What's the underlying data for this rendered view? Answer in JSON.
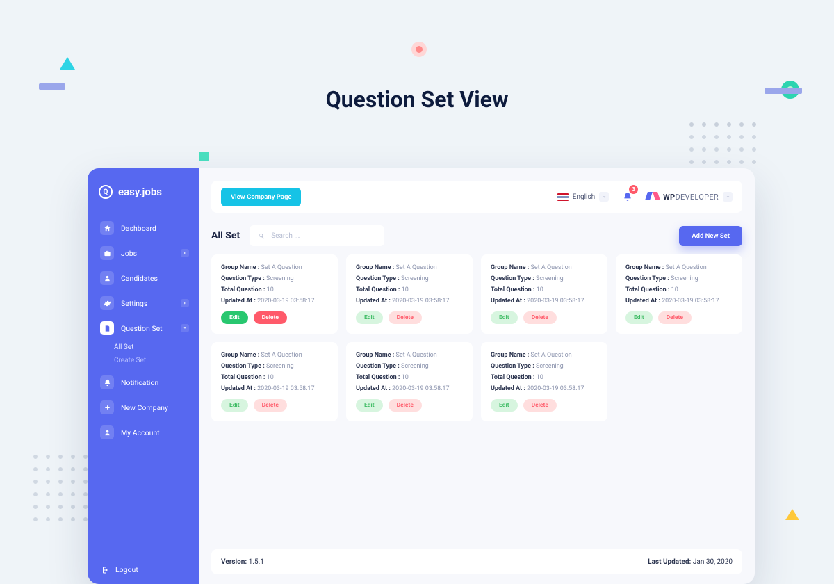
{
  "page_heading": "Question Set View",
  "logo_text": "easy.jobs",
  "sidebar": {
    "dashboard": "Dashboard",
    "jobs": "Jobs",
    "candidates": "Candidates",
    "settings": "Settings",
    "question_set": "Question Set",
    "qs_all": "All Set",
    "qs_create": "Create Set",
    "notification": "Notification",
    "new_company": "New Company",
    "my_account": "My Account",
    "logout": "Logout"
  },
  "topbar": {
    "view_company": "View Company Page",
    "language": "English",
    "notif_count": "3",
    "brand_main": "WP",
    "brand_sub": "DEVELOPER"
  },
  "section": {
    "title": "All Set",
    "search_placeholder": "Search ...",
    "add_btn": "Add New Set"
  },
  "labels": {
    "group": "Group Name :",
    "qtype": "Question Type :",
    "total": "Total Question :",
    "updated": "Updated At :",
    "edit": "Edit",
    "delete": "Delete"
  },
  "card_values": {
    "group": "Set A Question",
    "qtype": "Screening",
    "total": "10",
    "updated": "2020-03-19 03:58:17"
  },
  "footer": {
    "version_label": "Version:",
    "version": "1.5.1",
    "updated_label": "Last Updated:",
    "updated": "Jan 30, 2020"
  }
}
